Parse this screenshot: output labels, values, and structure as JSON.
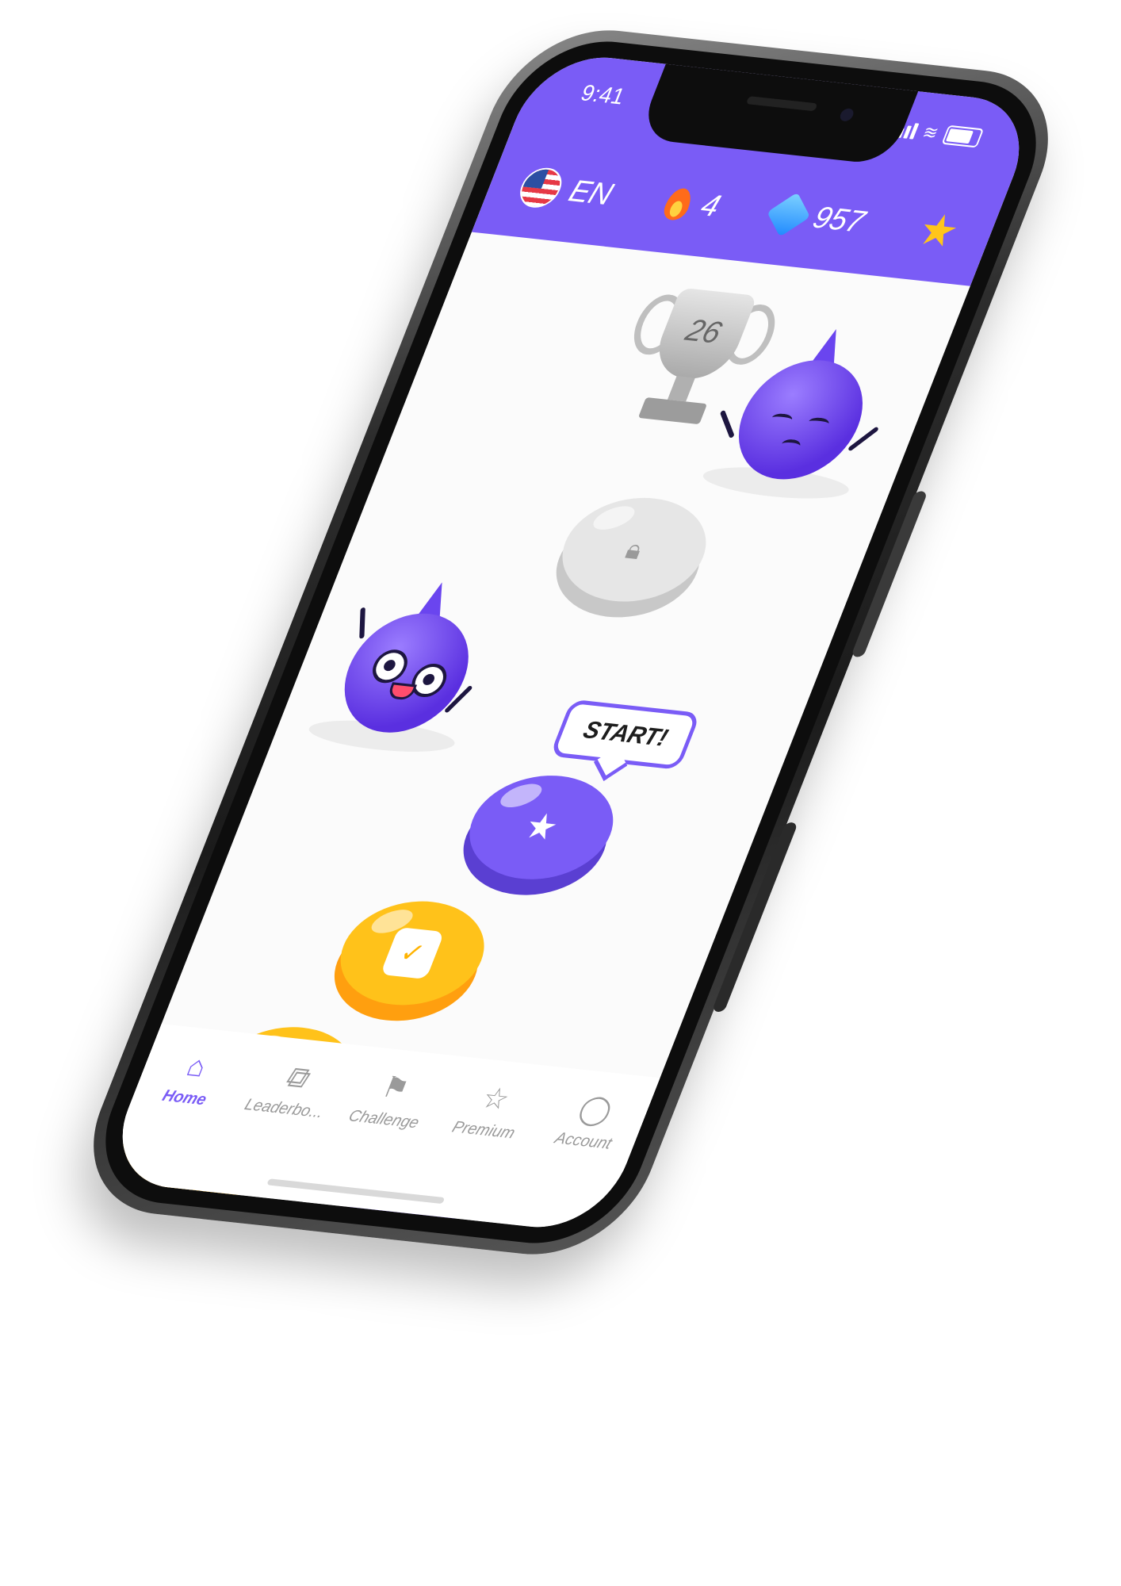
{
  "status_bar": {
    "time": "9:41"
  },
  "header": {
    "language_code": "EN",
    "streak_count": "4",
    "gems_count": "957"
  },
  "trophy": {
    "level": "26"
  },
  "start_bubble": {
    "label": "START!"
  },
  "tabs": [
    {
      "label": "Home",
      "icon": "home-icon",
      "active": true
    },
    {
      "label": "Leaderbo...",
      "icon": "leaderboard-icon",
      "active": false
    },
    {
      "label": "Challenge",
      "icon": "challenge-icon",
      "active": false
    },
    {
      "label": "Premium",
      "icon": "star-icon",
      "active": false
    },
    {
      "label": "Account",
      "icon": "account-icon",
      "active": false
    }
  ],
  "colors": {
    "brand": "#7a5cf6",
    "gold": "#ffc21a",
    "locked": "#e6e6e6"
  }
}
